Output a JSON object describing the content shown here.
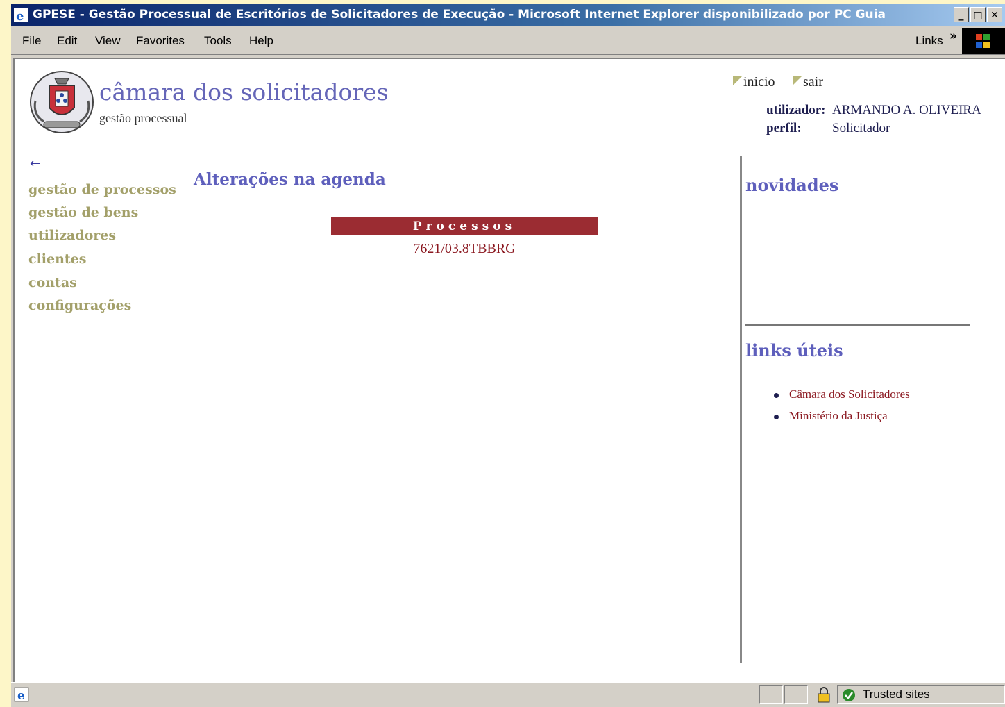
{
  "window": {
    "title": "GPESE - Gestão Processual de Escritórios de Solicitadores de Execução - Microsoft Internet Explorer disponibilizado por PC Guia"
  },
  "menubar": {
    "items": [
      "File",
      "Edit",
      "View",
      "Favorites",
      "Tools",
      "Help"
    ],
    "links_label": "Links",
    "chevron": "»"
  },
  "header": {
    "site_title": "câmara dos solicitadores",
    "site_subtitle": "gestão processual",
    "top_links": [
      "inicio",
      "sair"
    ],
    "user_label": "utilizador:",
    "user_value": "ARMANDO A. OLIVEIRA",
    "profile_label": "perfil:",
    "profile_value": "Solicitador"
  },
  "nav": {
    "back": "←",
    "items": [
      "gestão de processos",
      "gestão de bens",
      "utilizadores",
      "clientes",
      "contas",
      "configurações"
    ]
  },
  "main": {
    "title": "Alterações na agenda",
    "table_header": "Processos",
    "process_link": "7621/03.8TBBRG"
  },
  "sidebar": {
    "news_heading": "novidades",
    "links_heading": "links úteis",
    "links": [
      "Câmara dos Solicitadores",
      "Ministério da Justiça"
    ]
  },
  "statusbar": {
    "zone": "Trusted sites"
  },
  "colors": {
    "accent_blue": "#5e5fbc",
    "nav_olive": "#a3a06a",
    "header_red": "#9b2c32",
    "link_red": "#8b1820"
  }
}
